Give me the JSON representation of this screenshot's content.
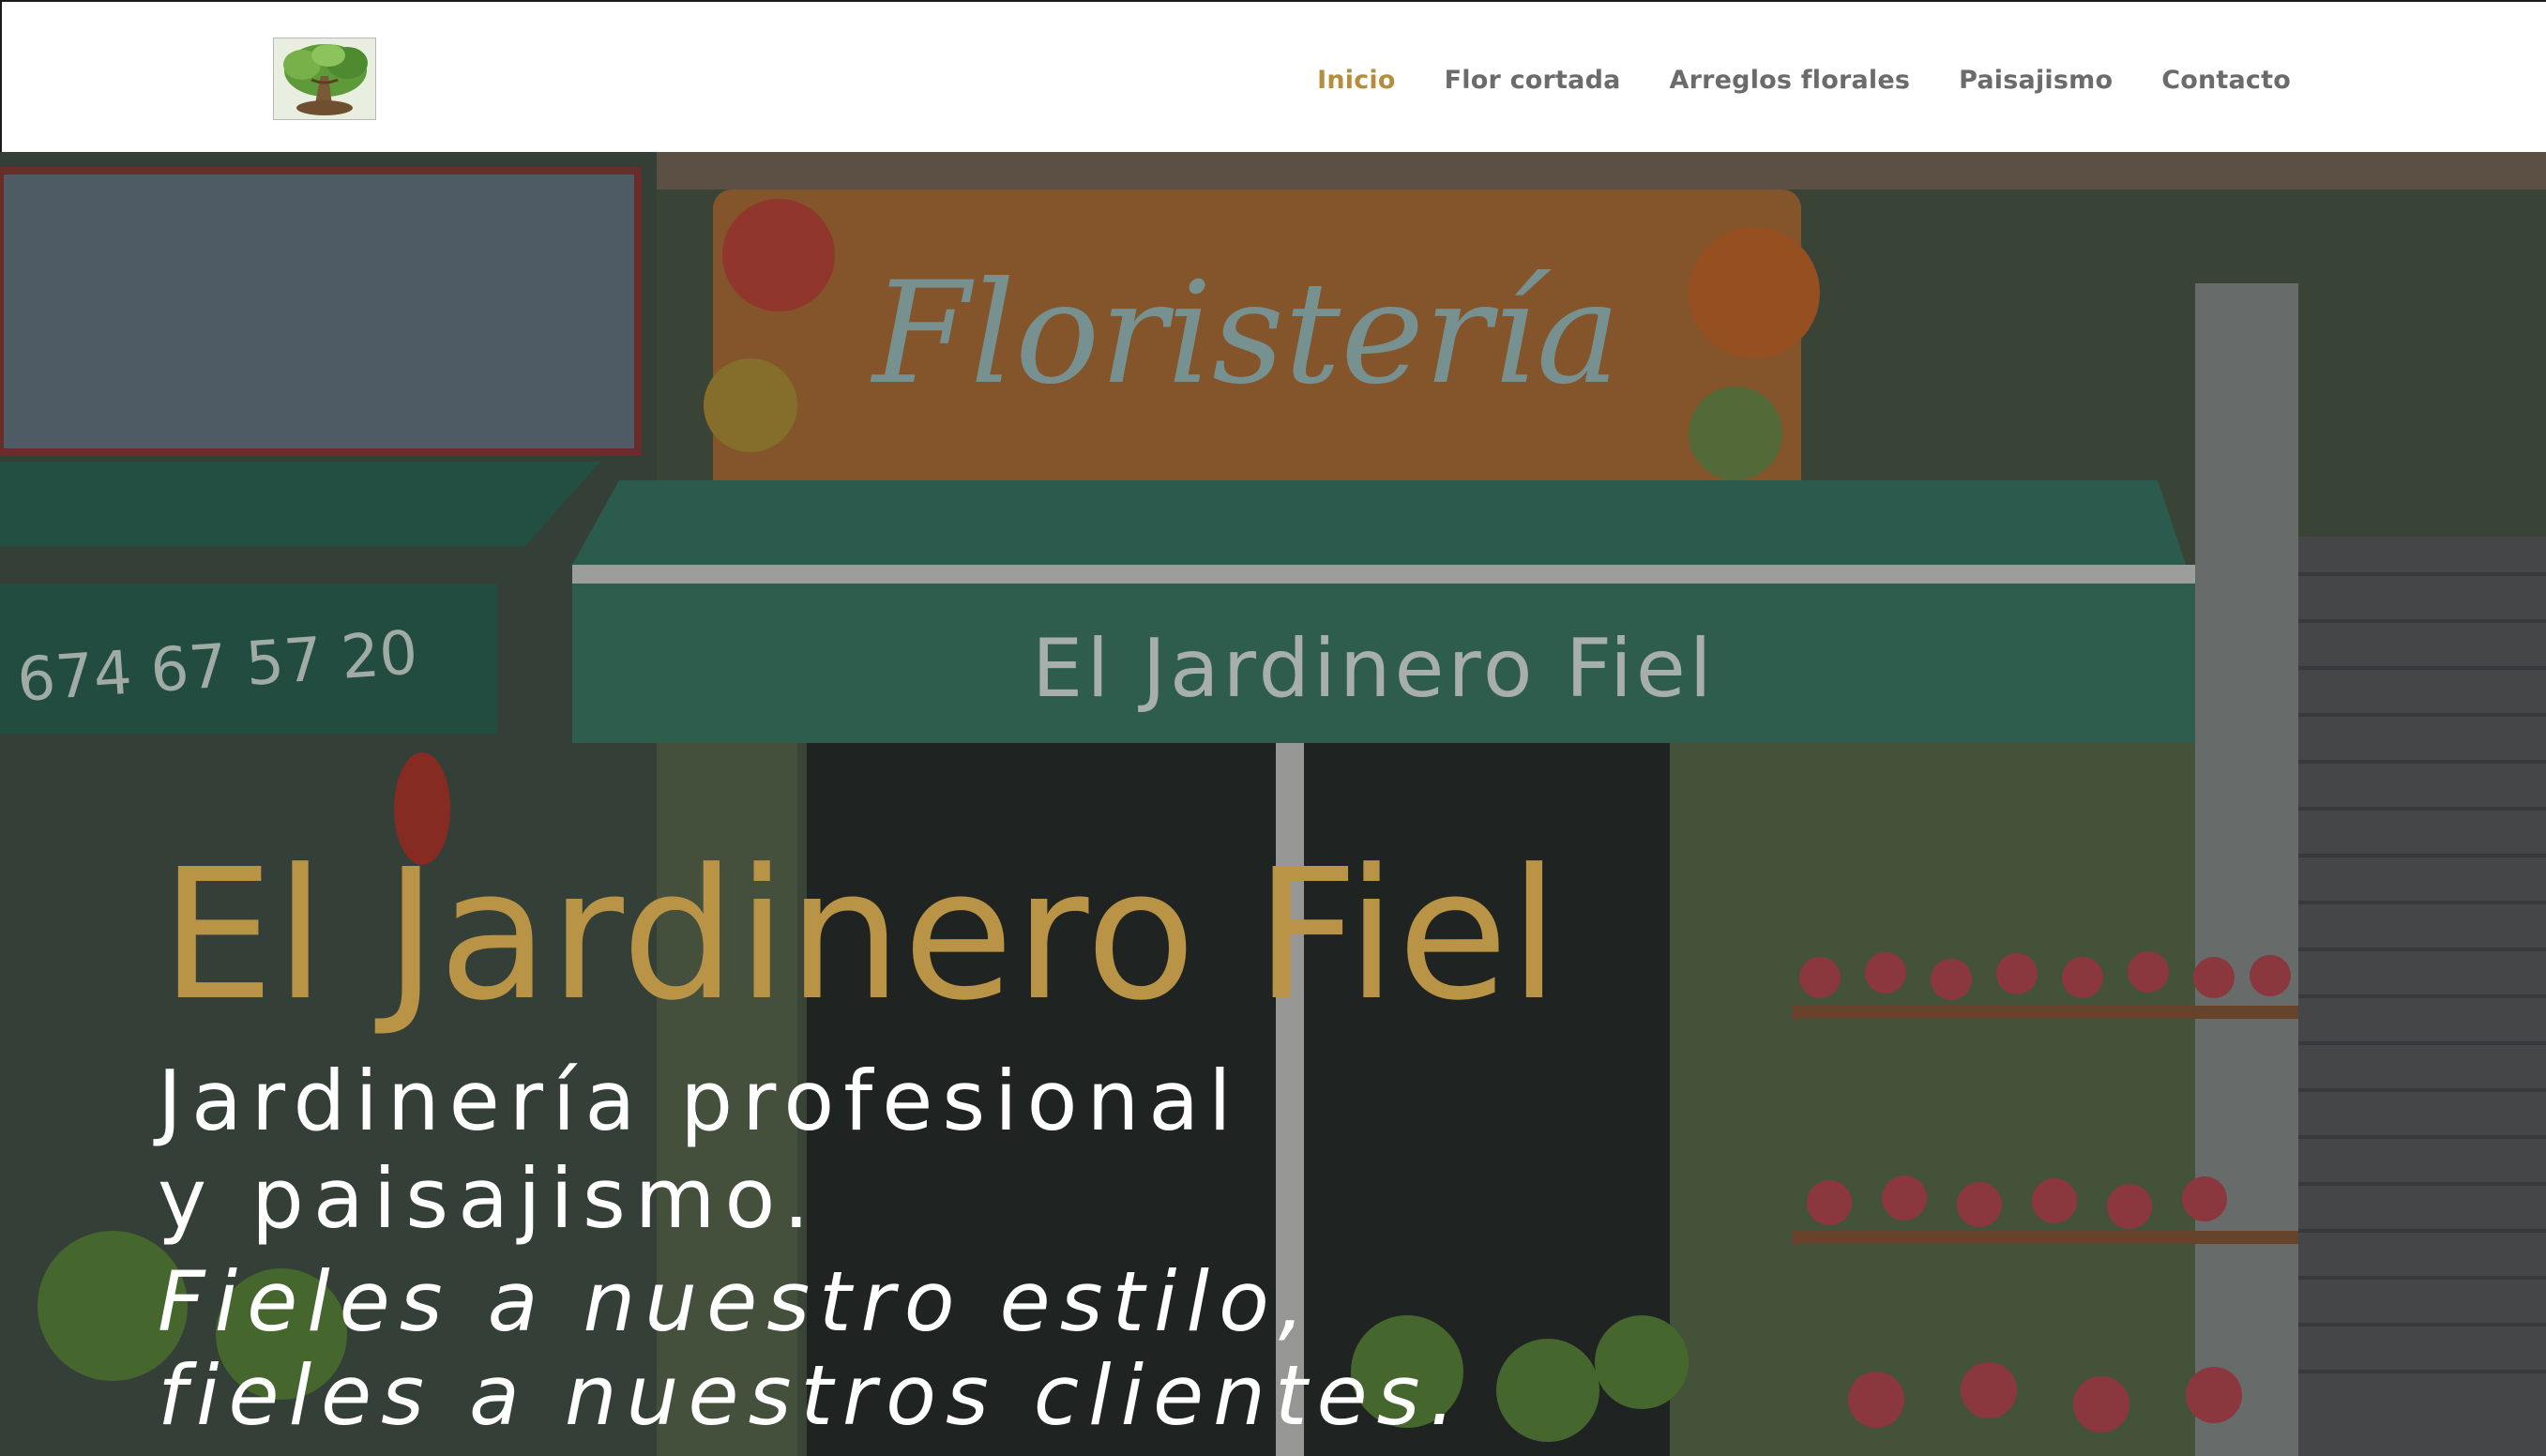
{
  "header": {
    "logo_alt": "El Jardinero Fiel logo",
    "nav": [
      {
        "label": "Inicio",
        "active": true
      },
      {
        "label": "Flor cortada",
        "active": false
      },
      {
        "label": "Arreglos florales",
        "active": false
      },
      {
        "label": "Paisajismo",
        "active": false
      },
      {
        "label": "Contacto",
        "active": false
      }
    ]
  },
  "hero": {
    "photo_signs": {
      "top_sign": "Floristería",
      "awning_text": "El Jardinero Fiel",
      "phone": "674 67 57 20"
    },
    "title": "El Jardinero Fiel",
    "subtitle_line1": "Jardinería profesional",
    "subtitle_line2": "y paisajismo.",
    "tagline_line1": "Fieles a nuestro estilo,",
    "tagline_line2": "fieles a nuestros clientes."
  },
  "colors": {
    "accent_gold": "#b48e3f",
    "title_gold": "#b99447",
    "nav_text": "#6b6b6b",
    "awning_green": "#3e7d69"
  },
  "icons": [
    "logo-tree-image"
  ]
}
